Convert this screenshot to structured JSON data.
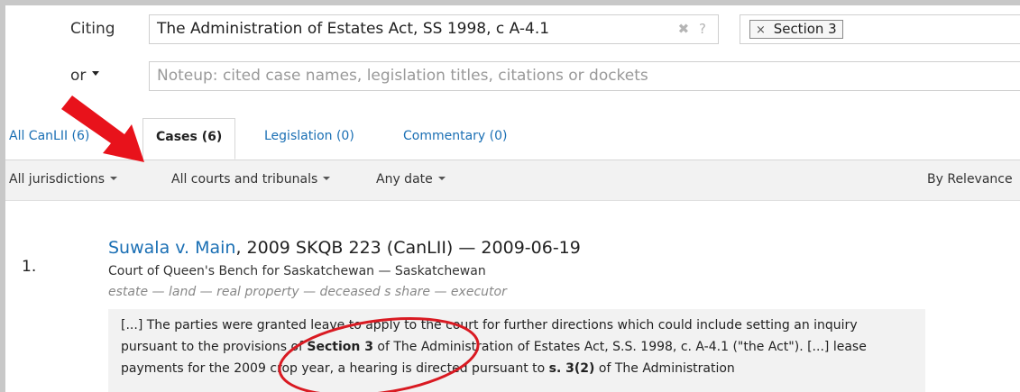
{
  "search": {
    "citing_label": "Citing",
    "citing_value": "The Administration of Estates Act, SS 1998, c A-4.1",
    "clear_glyph": "✖",
    "help_glyph": "?",
    "section_chip_x": "×",
    "section_chip": "Section 3",
    "or_label": "or",
    "noteup_placeholder": "Noteup: cited case names, legislation titles, citations or dockets"
  },
  "tabs": [
    {
      "label": "All CanLII (6)"
    },
    {
      "label": "Cases (6)"
    },
    {
      "label": "Legislation (0)"
    },
    {
      "label": "Commentary (0)"
    }
  ],
  "filters": {
    "jurisdictions": "All jurisdictions",
    "courts": "All courts and tribunals",
    "date": "Any date",
    "sort": "By Relevance"
  },
  "result": {
    "number": "1.",
    "case_name": "Suwala v. Main",
    "citation": ", 2009 SKQB 223 (CanLII) — 2009-06-19",
    "court": "Court of Queen's Bench for Saskatchewan — Saskatchewan",
    "keywords": "estate — land — real property — deceased s share — executor",
    "excerpt": {
      "part1": "[...]  The parties were granted leave to apply to the court for further directions which could include setting an inquiry pursuant to the provisions of ",
      "bold1": "Section 3",
      "part2": " of The Administration of Estates Act, S.S. 1998, c. A-4.1 (\"the Act\").  [...]  lease payments for the 2009 crop year, a hearing is directed pursuant to ",
      "bold2": "s. 3(2)",
      "part3": " of The Administration"
    }
  },
  "annotation_colors": {
    "arrow": "#e8121b",
    "circle": "#d91a22",
    "link": "#1a6fb4"
  }
}
